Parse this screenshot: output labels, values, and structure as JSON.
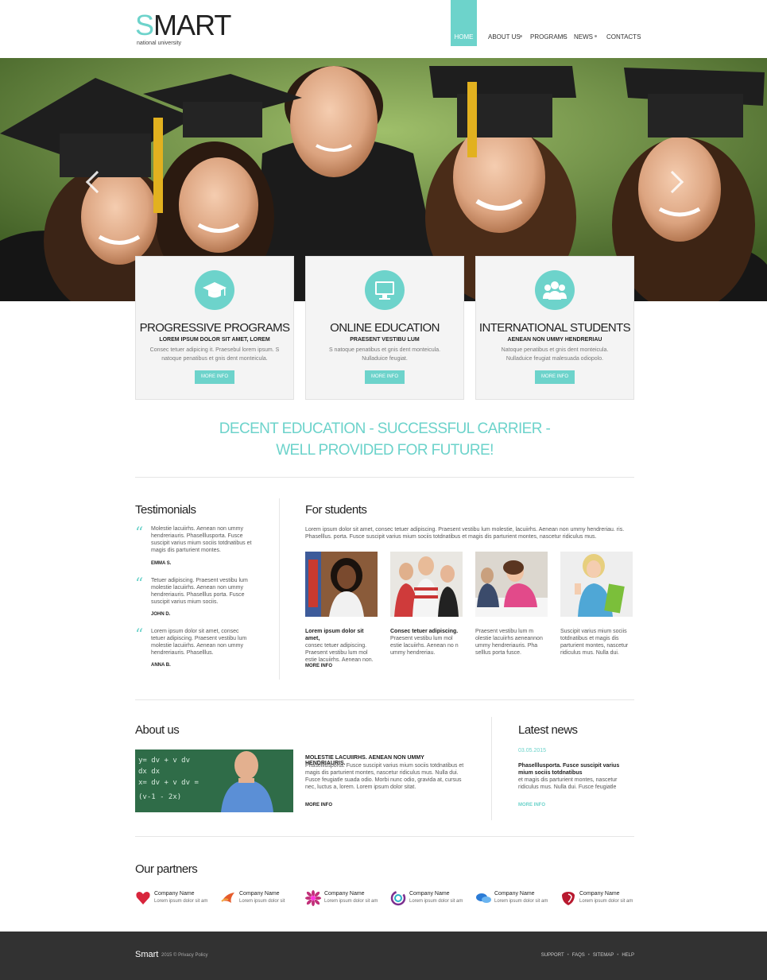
{
  "header": {
    "logo_first": "S",
    "logo_rest": "MART",
    "logo_sub": "national university",
    "nav": [
      {
        "label": "HOME",
        "active": true
      },
      {
        "label": "ABOUT US"
      },
      {
        "label": "PROGRAMS"
      },
      {
        "label": "NEWS"
      },
      {
        "label": "CONTACTS"
      }
    ]
  },
  "features": [
    {
      "title": "PROGRESSIVE PROGRAMS",
      "subtitle": "LOREM IPSUM DOLOR SIT AMET, LOREM",
      "text": "Consec tetuer adipicing it. Praesebul lorem ipsum. S natoque penatibus et gnis dent monteicula.",
      "button": "MORE INFO",
      "icon": "graduation-cap-icon"
    },
    {
      "title": "ONLINE EDUCATION",
      "subtitle": "PRAESENT VESTIBU LUM",
      "text": "S natoque penatibus et gnis dent monteicula. Nulladuice feugiat.",
      "button": "MORE INFO",
      "icon": "monitor-icon"
    },
    {
      "title": "INTERNATIONAL STUDENTS",
      "subtitle": "AENEAN NON UMMY HENDRERIAU",
      "text": "Natoque penatibus et gnis dent monteicula. Nulladuice feugiat malesuada odiopolo.",
      "button": "MORE INFO",
      "icon": "people-icon"
    }
  ],
  "tagline": {
    "line1": "DECENT EDUCATION - SUCCESSFUL CARRIER -",
    "line2": "WELL PROVIDED FOR FUTURE!"
  },
  "testimonials": {
    "title": "Testimonials",
    "items": [
      {
        "text": "Molestie lacuiirhs. Aenean non ummy hendreriauris. Phaselllusporta. Fusce suscipit varius mium sociis totdnatibus et magis dis parturient montes.",
        "author": "EMMA S."
      },
      {
        "text": "Tetuer adipiscing. Praesent vestibu lum molestie lacuiirhs. Aenean non ummy hendreriauris. Phaselllus porta. Fusce suscipit varius mium sociis.",
        "author": "JOHN D."
      },
      {
        "text": "Lorem ipsum dolor sit amet, consec tetuer adipiscing. Praesent vestibu lum molestie lacuiirhs. Aenean non ummy hendreriauris. Phaselllus.",
        "author": "ANNA B."
      }
    ]
  },
  "students": {
    "title": "For students",
    "intro": "Lorem ipsum dolor sit amet, consec tetuer adipiscing. Praesent vestibu lum molestie, lacuiirhs. Aenean non ummy hendreriau. ris. Phaselllus. porta. Fusce suscipit varius mium sociis totdnatibus et magis dis parturient montes, nascetur ridiculus mus.",
    "items": [
      {
        "bold": "Lorem ipsum dolor sit amet,",
        "text": "consec tetuer adipiscing. Praesent vestibu lum mol estie lacuiirhs. Aenean non."
      },
      {
        "bold": "Consec tetuer adipiscing.",
        "text": "Praesent vestibu lum mol estie lacuiirhs. Aenean no n ummy hendreriau."
      },
      {
        "bold": "",
        "text": "Praesent vestibu lum m olestie lacuiirhs aeneannon ummy hendreriauris. Pha selllus porta fusce."
      },
      {
        "bold": "",
        "text": "Suscipit varius mium sociis totdnatibus et magis dis parturient montes, nascetur ridiculus mus. Nulla dui."
      }
    ],
    "more": "MORE INFO"
  },
  "about": {
    "title": "About us",
    "bold": "MOLESTIE LACUIIRHS. AENEAN NON UMMY HENDRIAURIS.",
    "text": "Phaselllusporta. Fusce suscipit varius mium sociis totdnatibus et magis dis parturient montes, nascetur ridiculus mus. Nulla dui. Fusce feugiatle suada odio. Morbi nunc odio, gravida at, cursus nec, luctus a, lorem. Lorem ipsum dolor sitat.",
    "more": "MORE INFO"
  },
  "news": {
    "title": "Latest news",
    "date": "03.05.2015",
    "bold": "Phaselllusporta. Fusce suscipit varius mium sociis totdnatibus",
    "text": "et magis dis parturient montes, nascetur ridiculus mus. Nulla dui. Fusce feugiatle",
    "more": "MORE INFO"
  },
  "partners": {
    "title": "Our partners",
    "items": [
      {
        "name": "Company Name",
        "desc": "Lorem ipsum dolor sit am",
        "color": "#d8253c",
        "icon": "heart-logo-icon"
      },
      {
        "name": "Company Name",
        "desc": "Lorem ipsum dolor sit",
        "color": "#e55b2b",
        "icon": "ribbon-logo-icon"
      },
      {
        "name": "Company Name",
        "desc": "Lorem ipsum dolor sit am",
        "color": "#c2307a",
        "icon": "flower-logo-icon"
      },
      {
        "name": "Company Name",
        "desc": "Lorem ipsum dolor sit am",
        "color": "#7b2f8f",
        "icon": "swirl-logo-icon"
      },
      {
        "name": "Company Name",
        "desc": "Lorem ipsum dolor sit am",
        "color": "#2b7bd6",
        "icon": "bubbles-logo-icon"
      },
      {
        "name": "Company Name",
        "desc": "Lorem ipsum dolor sit am",
        "color": "#b8192f",
        "icon": "shield-logo-icon"
      }
    ]
  },
  "footer": {
    "logo": "Smart",
    "copy": "2015 © Privacy Policy",
    "links": [
      "SUPPORT",
      "FAQS",
      "SITEMAP",
      "HELP"
    ]
  },
  "colors": {
    "accent": "#6dd3cb",
    "footer": "#323232"
  }
}
